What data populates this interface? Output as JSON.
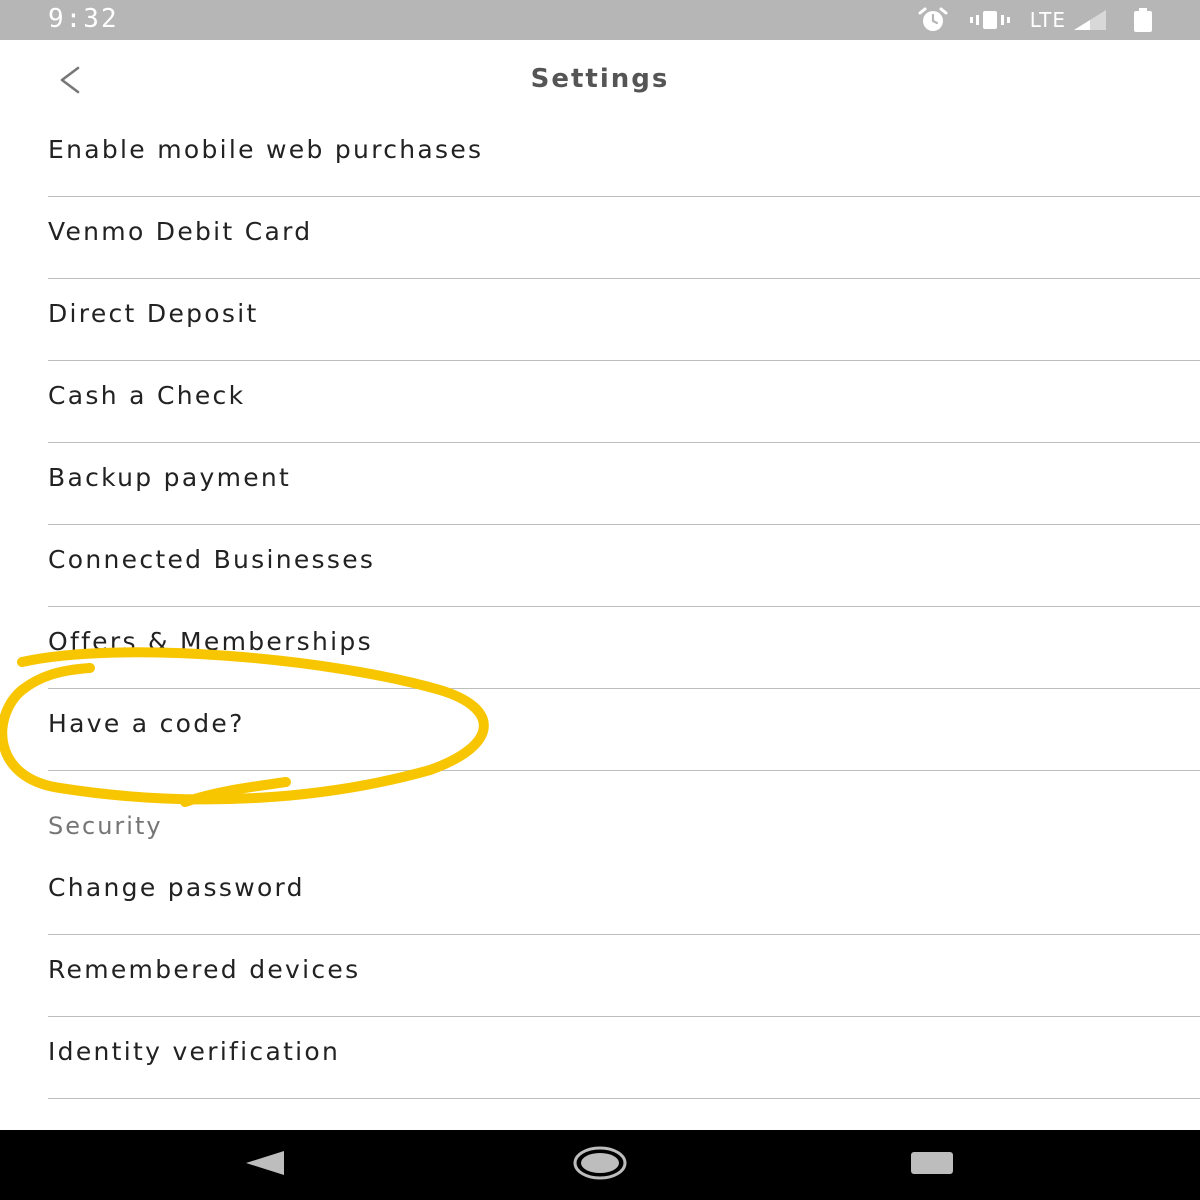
{
  "status_bar": {
    "time": "9:32",
    "network": "LTE",
    "icons": [
      "alarm-icon",
      "vibrate-icon",
      "signal-icon",
      "battery-icon"
    ]
  },
  "header": {
    "title": "Settings",
    "back_icon": "chevron-left-icon"
  },
  "settings": {
    "items": [
      {
        "label": "Enable mobile web purchases"
      },
      {
        "label": "Venmo Debit Card"
      },
      {
        "label": "Direct Deposit"
      },
      {
        "label": "Cash a Check"
      },
      {
        "label": "Backup payment"
      },
      {
        "label": "Connected Businesses"
      },
      {
        "label": "Offers & Memberships"
      },
      {
        "label": "Have a code?"
      }
    ]
  },
  "security": {
    "header": "Security",
    "items": [
      {
        "label": "Change password"
      },
      {
        "label": "Remembered devices"
      },
      {
        "label": "Identity verification"
      }
    ]
  },
  "annotation": {
    "color": "#f8c600",
    "circled_item": "Have a code?"
  },
  "nav_bar": {
    "buttons": [
      "back-triangle-icon",
      "home-circle-icon",
      "recents-square-icon"
    ]
  }
}
